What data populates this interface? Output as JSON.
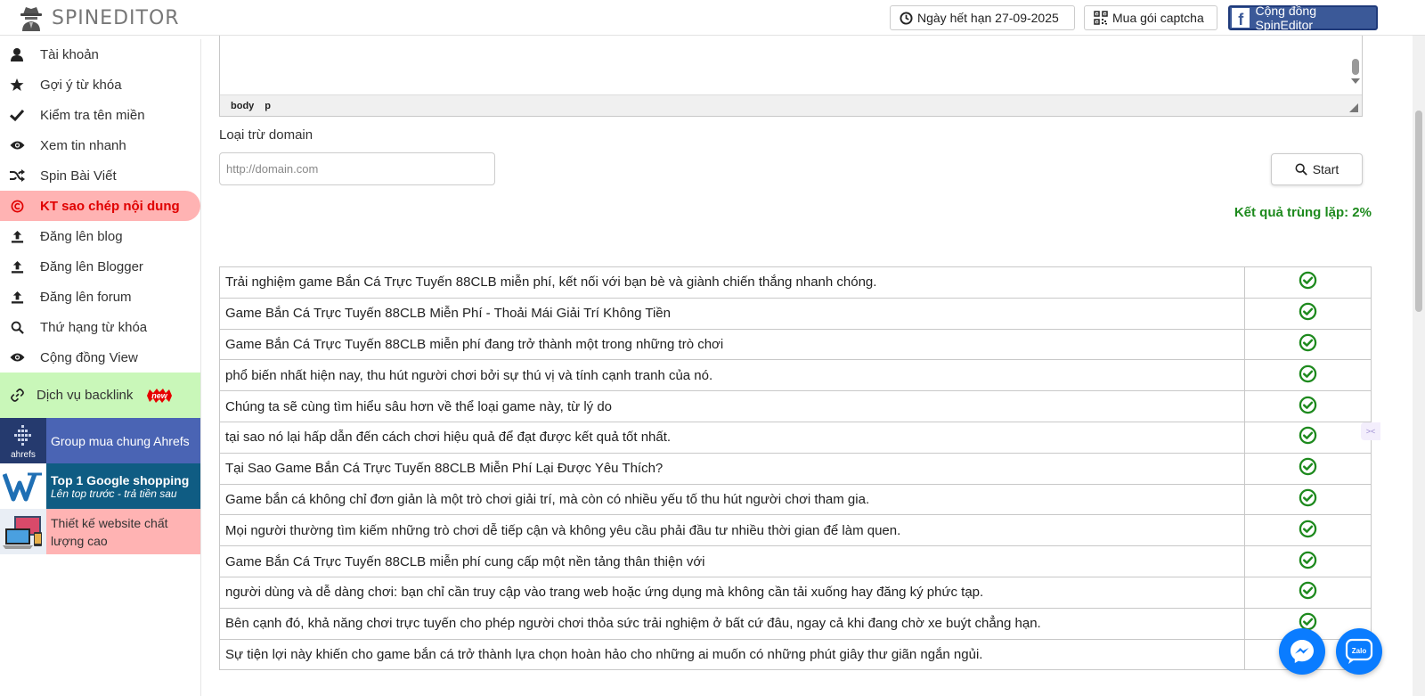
{
  "header": {
    "brand": "SPINEDITOR",
    "expiry_label": "Ngày hết hạn 27-09-2025",
    "captcha_label": "Mua gói captcha",
    "community_label": "Cộng đồng SpinEditor"
  },
  "sidebar": {
    "items": [
      {
        "label": "Tài khoản",
        "icon": "user-icon"
      },
      {
        "label": "Gợi ý từ khóa",
        "icon": "star-icon"
      },
      {
        "label": "Kiểm tra tên miền",
        "icon": "check-icon"
      },
      {
        "label": "Xem tin nhanh",
        "icon": "eye-icon"
      },
      {
        "label": "Spin Bài Viết",
        "icon": "shuffle-icon"
      },
      {
        "label": "KT sao chép nội dung",
        "icon": "copyright-icon",
        "active": true
      },
      {
        "label": "Đăng lên blog",
        "icon": "upload-icon"
      },
      {
        "label": "Đăng lên Blogger",
        "icon": "upload-icon"
      },
      {
        "label": "Đăng lên forum",
        "icon": "upload-icon"
      },
      {
        "label": "Thứ hạng từ khóa",
        "icon": "search-icon"
      },
      {
        "label": "Cộng đồng View",
        "icon": "eye-icon"
      }
    ],
    "backlink_label": "Dịch vụ backlink",
    "new_badge": "new",
    "promos": {
      "ahrefs_logo": "ahrefs",
      "ahrefs_label": "Group mua chung Ahrefs",
      "google_title": "Top 1 Google shopping",
      "google_sub": "Lên top trước - trả tiền sau",
      "web_label": "Thiết kế website chất lượng cao"
    }
  },
  "editor": {
    "path_body": "body",
    "path_p": "p"
  },
  "form": {
    "exclude_label": "Loại trừ domain",
    "domain_placeholder": "http://domain.com",
    "start_label": "Start",
    "result_text": "Kết quả trùng lặp: 2%"
  },
  "results": [
    "Trải nghiệm game Bắn Cá Trực Tuyến 88CLB miễn phí, kết nối với bạn bè và giành chiến thắng nhanh chóng.",
    "Game Bắn Cá Trực Tuyến 88CLB Miễn Phí - Thoải Mái Giải Trí Không Tiền",
    "Game Bắn Cá Trực Tuyến 88CLB miễn phí đang trở thành một trong những trò chơi",
    "phổ biến nhất hiện nay, thu hút người chơi bởi sự thú vị và tính cạnh tranh của nó.",
    "Chúng ta sẽ cùng tìm hiểu sâu hơn về thể loại game này, từ lý do",
    "tại sao nó lại hấp dẫn đến cách chơi hiệu quả để đạt được kết quả tốt nhất.",
    "Tại Sao Game Bắn Cá Trực Tuyến 88CLB Miễn Phí Lại Được Yêu Thích?",
    "Game bắn cá không chỉ đơn giản là một trò chơi giải trí, mà còn có nhiều yếu tố thu hút người chơi tham gia.",
    "Mọi người thường tìm kiếm những trò chơi dễ tiếp cận và không yêu cầu phải đầu tư nhiều thời gian để làm quen.",
    "Game Bắn Cá Trực Tuyến 88CLB miễn phí cung cấp một nền tảng thân thiện với",
    "người dùng và dễ dàng chơi: bạn chỉ cần truy cập vào trang web hoặc ứng dụng mà không cần tải xuống hay đăng ký phức tạp.",
    "Bên cạnh đó, khả năng chơi trực tuyến cho phép người chơi thỏa sức trải nghiệm ở bất cứ đâu, ngay cả khi đang chờ xe buýt chẳng hạn.",
    "Sự tiện lợi này khiến cho game bắn cá trở thành lựa chọn hoàn hảo cho những ai muốn có những phút giây thư giãn ngắn ngủi."
  ],
  "fab": {
    "zalo_label": "Zalo"
  },
  "colors": {
    "active_bg": "#ffb3b3",
    "active_text": "#e00000",
    "result_green": "#1e8a1e",
    "check_green": "#1e8a1e",
    "facebook_blue": "#3b5998"
  }
}
